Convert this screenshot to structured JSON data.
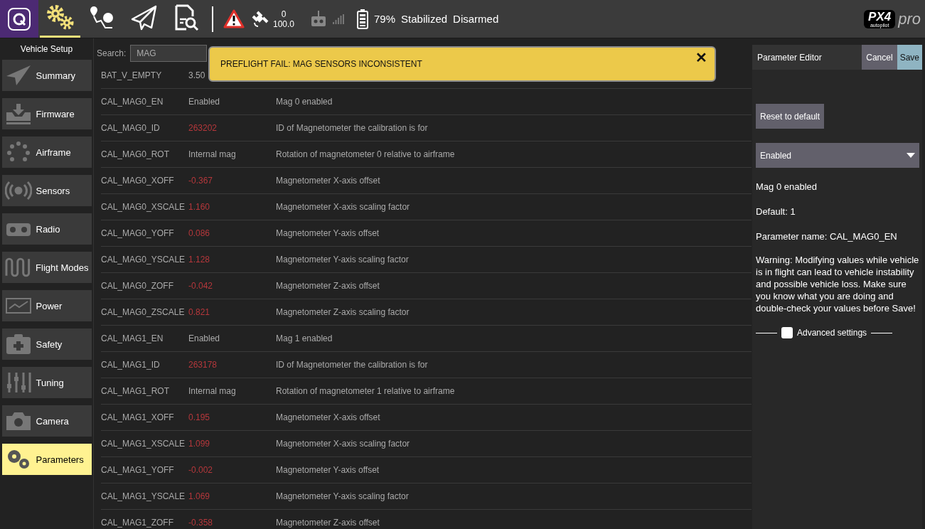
{
  "toolbar": {
    "tools": [
      {
        "kind": "gears",
        "selected": true
      },
      {
        "kind": "plan",
        "selected": false
      },
      {
        "kind": "fly",
        "selected": false
      },
      {
        "kind": "analyze",
        "selected": false
      }
    ],
    "gps": {
      "count": "0",
      "hdop": "100.0"
    },
    "battery": "79%",
    "flight_mode": "Stabilized",
    "arm_state": "Disarmed"
  },
  "logo": {
    "main": "PX4",
    "sub": "autopilot",
    "suffix": "pro"
  },
  "sidebar": {
    "title": "Vehicle Setup",
    "items": [
      {
        "label": "Summary",
        "selected": false
      },
      {
        "label": "Firmware",
        "selected": false
      },
      {
        "label": "Airframe",
        "selected": false
      },
      {
        "label": "Sensors",
        "selected": false
      },
      {
        "label": "Radio",
        "selected": false
      },
      {
        "label": "Flight Modes",
        "selected": false
      },
      {
        "label": "Power",
        "selected": false
      },
      {
        "label": "Safety",
        "selected": false
      },
      {
        "label": "Tuning",
        "selected": false
      },
      {
        "label": "Camera",
        "selected": false
      },
      {
        "label": "Parameters",
        "selected": true
      }
    ]
  },
  "search": {
    "label": "Search:",
    "value": "MAG"
  },
  "alert": {
    "message": "PREFLIGHT FAIL: MAG SENSORS INCONSISTENT",
    "close": "✕"
  },
  "parameters": [
    {
      "name": "BAT_V_EMPTY",
      "value": "3.50",
      "modified": false
    },
    {
      "name": "CAL_MAG0_EN",
      "value": "Enabled",
      "modified": false,
      "description": "Mag 0 enabled"
    },
    {
      "name": "CAL_MAG0_ID",
      "value": "263202",
      "modified": true,
      "description": "ID of Magnetometer the calibration is for"
    },
    {
      "name": "CAL_MAG0_ROT",
      "value": "Internal mag",
      "modified": false,
      "description": "Rotation of magnetometer 0 relative to airframe"
    },
    {
      "name": "CAL_MAG0_XOFF",
      "value": "-0.367",
      "modified": true,
      "description": "Magnetometer X-axis offset"
    },
    {
      "name": "CAL_MAG0_XSCALE",
      "value": "1.160",
      "modified": true,
      "description": "Magnetometer X-axis scaling factor"
    },
    {
      "name": "CAL_MAG0_YOFF",
      "value": "0.086",
      "modified": true,
      "description": "Magnetometer Y-axis offset"
    },
    {
      "name": "CAL_MAG0_YSCALE",
      "value": "1.128",
      "modified": true,
      "description": "Magnetometer Y-axis scaling factor"
    },
    {
      "name": "CAL_MAG0_ZOFF",
      "value": "-0.042",
      "modified": true,
      "description": "Magnetometer Z-axis offset"
    },
    {
      "name": "CAL_MAG0_ZSCALE",
      "value": "0.821",
      "modified": true,
      "description": "Magnetometer Z-axis scaling factor"
    },
    {
      "name": "CAL_MAG1_EN",
      "value": "Enabled",
      "modified": false,
      "description": "Mag 1 enabled"
    },
    {
      "name": "CAL_MAG1_ID",
      "value": "263178",
      "modified": true,
      "description": "ID of Magnetometer the calibration is for"
    },
    {
      "name": "CAL_MAG1_ROT",
      "value": "Internal mag",
      "modified": false,
      "description": "Rotation of magnetometer 1 relative to airframe"
    },
    {
      "name": "CAL_MAG1_XOFF",
      "value": "0.195",
      "modified": true,
      "description": "Magnetometer X-axis offset"
    },
    {
      "name": "CAL_MAG1_XSCALE",
      "value": "1.099",
      "modified": true,
      "description": "Magnetometer X-axis scaling factor"
    },
    {
      "name": "CAL_MAG1_YOFF",
      "value": "-0.002",
      "modified": true,
      "description": "Magnetometer Y-axis offset"
    },
    {
      "name": "CAL_MAG1_YSCALE",
      "value": "1.069",
      "modified": true,
      "description": "Magnetometer Y-axis scaling factor"
    },
    {
      "name": "CAL_MAG1_ZOFF",
      "value": "-0.358",
      "modified": true,
      "description": "Magnetometer Z-axis offset"
    }
  ],
  "editor": {
    "title": "Parameter Editor",
    "cancel": "Cancel",
    "save": "Save",
    "reset": "Reset to default",
    "value": "Enabled",
    "description": "Mag 0 enabled",
    "default": "Default: 1",
    "param_name": "Parameter name: CAL_MAG0_EN",
    "warning": "Warning: Modifying values while vehicle is in flight can lead to vehicle instability and possible vehicle loss. Make sure you know what you are doing and double-check your values before Save!",
    "advanced": {
      "label": "Advanced settings",
      "checked": false
    }
  }
}
